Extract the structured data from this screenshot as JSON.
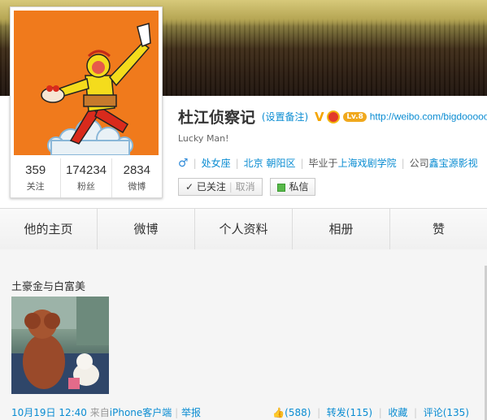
{
  "profile": {
    "name": "杜江侦察记",
    "remark_link": "(设置备注)",
    "level_badge": "Lv.8",
    "url": "http://weibo.com/bigdooooo",
    "motto": "Lucky Man!",
    "gender_symbol": "♂",
    "zodiac": "处女座",
    "location": "北京 朝阳区",
    "school_prefix": "毕业于",
    "school": "上海戏剧学院",
    "company_prefix": "公司",
    "company": "鑫宝源影视"
  },
  "stats": [
    {
      "value": "359",
      "label": "关注"
    },
    {
      "value": "174234",
      "label": "粉丝"
    },
    {
      "value": "2834",
      "label": "微博"
    }
  ],
  "buttons": {
    "followed": "已关注",
    "cancel": "取消",
    "message": "私信"
  },
  "nav": [
    "他的主页",
    "微博",
    "个人资料",
    "相册",
    "赞"
  ],
  "post": {
    "text": "土豪金与白富美",
    "time": "10月19日 12:40",
    "from_prefix": "来自",
    "client": "iPhone客户端",
    "report": "举报",
    "likes": "(588)",
    "repost": "转发(115)",
    "favorite": "收藏",
    "comment": "评论(135)"
  }
}
